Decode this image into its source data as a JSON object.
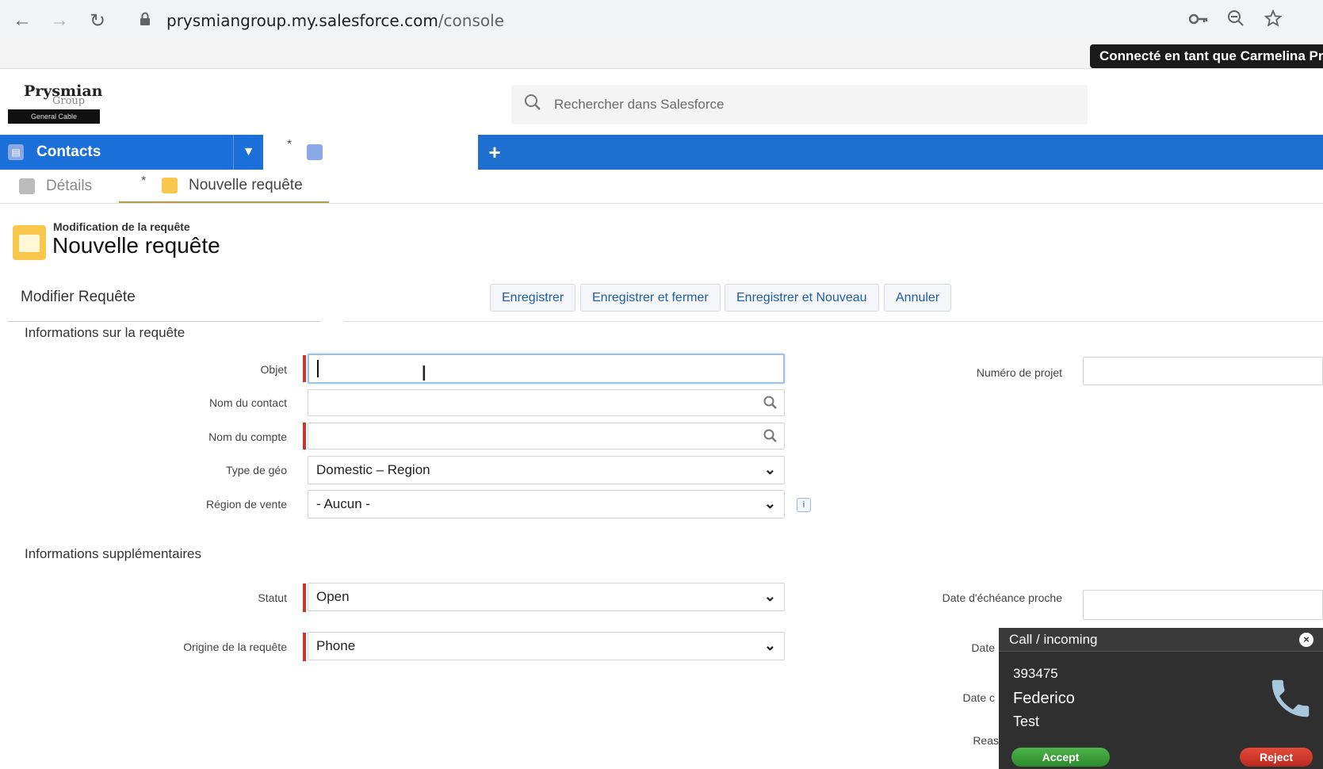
{
  "browser": {
    "url_host": "prysmiangroup.my.salesforce.com",
    "url_path": "/console",
    "back_icon": "←",
    "forward_icon": "→",
    "reload_icon": "↻"
  },
  "banner": {
    "connected_as": "Connecté en tant que Carmelina Pric"
  },
  "logo": {
    "brand": "Prysmian",
    "group": "Group",
    "tagline": "General Cable"
  },
  "search": {
    "placeholder": "Rechercher dans Salesforce"
  },
  "tabs": {
    "primary": "Contacts",
    "add": "+"
  },
  "subtabs": {
    "details": "Détails",
    "active": "Nouvelle requête",
    "modified_marker": "*"
  },
  "page": {
    "subtitle": "Modification de la requête",
    "title": "Nouvelle requête",
    "edit_title": "Modifier Requête"
  },
  "buttons": {
    "save": "Enregistrer",
    "save_close": "Enregistrer et fermer",
    "save_new": "Enregistrer et Nouveau",
    "cancel": "Annuler"
  },
  "sections": {
    "info": "Informations sur la requête",
    "extra": "Informations supplémentaires"
  },
  "fields": {
    "objet": {
      "label": "Objet",
      "value": ""
    },
    "contact": {
      "label": "Nom du contact",
      "value": ""
    },
    "compte": {
      "label": "Nom du compte",
      "value": ""
    },
    "geo": {
      "label": "Type de géo",
      "value": "Domestic – Region"
    },
    "region": {
      "label": "Région de vente",
      "value": "- Aucun -"
    },
    "statut": {
      "label": "Statut",
      "value": "Open"
    },
    "origine": {
      "label": "Origine de la requête",
      "value": "Phone"
    },
    "projet": {
      "label": "Numéro de projet",
      "value": ""
    },
    "echeance": {
      "label": "Date d'échéance proche",
      "value": ""
    },
    "date1": {
      "label": "Date"
    },
    "date2": {
      "label": "Date c"
    },
    "reason": {
      "label": "Reas"
    }
  },
  "call": {
    "title": "Call / incoming",
    "number": "393475",
    "first_name": "Federico",
    "last_name": "Test",
    "accept": "Accept",
    "reject": "Reject"
  }
}
